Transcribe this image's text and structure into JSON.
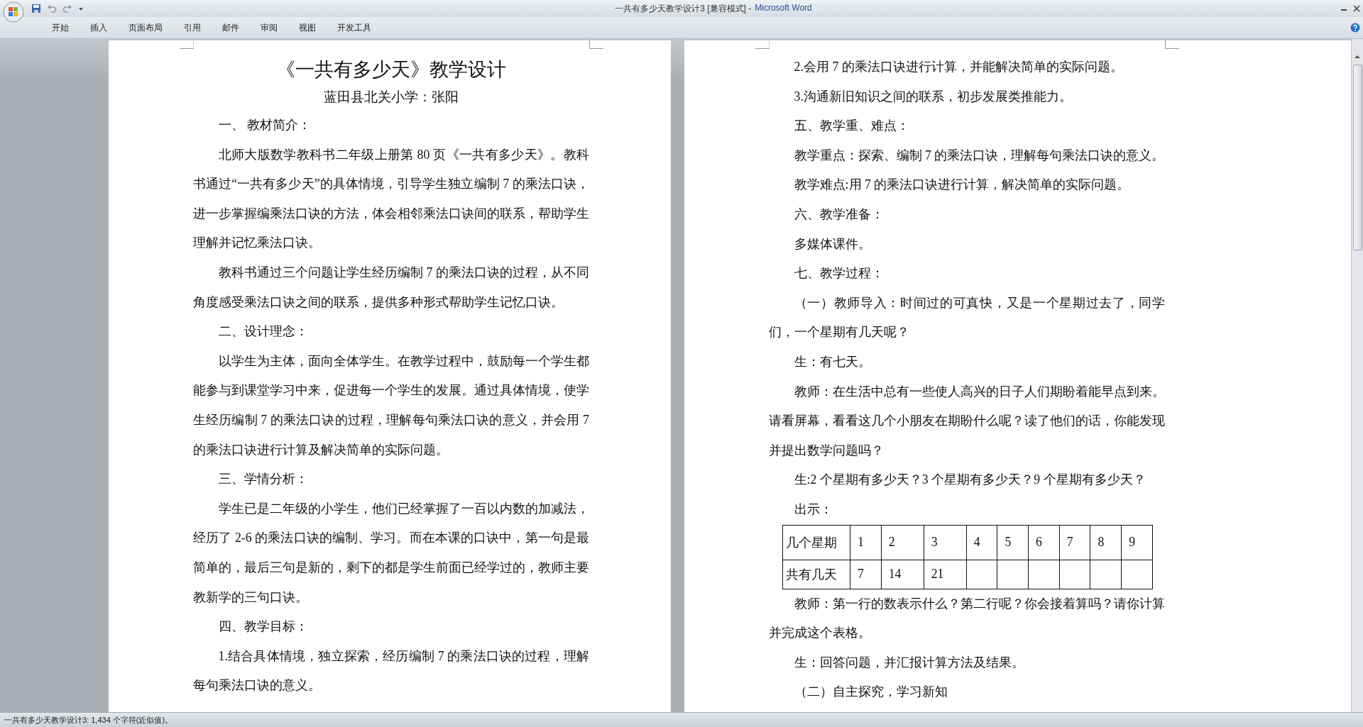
{
  "window": {
    "document_title": "一共有多少天教学设计3 [兼容模式] -",
    "app_name": "Microsoft Word"
  },
  "ribbon_tabs": [
    {
      "label": "开始",
      "selected": false
    },
    {
      "label": "插入",
      "selected": false
    },
    {
      "label": "页面布局",
      "selected": false
    },
    {
      "label": "引用",
      "selected": false
    },
    {
      "label": "邮件",
      "selected": false
    },
    {
      "label": "审阅",
      "selected": false
    },
    {
      "label": "视图",
      "selected": false
    },
    {
      "label": "开发工具",
      "selected": false
    }
  ],
  "pages": [
    {
      "blocks": [
        {
          "kind": "title",
          "text": "《一共有多少天》教学设计"
        },
        {
          "kind": "subtitle",
          "text": "蓝田县北关小学：张阳"
        },
        {
          "kind": "para",
          "text": "一、 教材简介："
        },
        {
          "kind": "para",
          "text": "北师大版数学教科书二年级上册第 80 页《一共有多少天》。教科书通过“一共有多少天”的具体情境，引导学生独立编制 7 的乘法口诀，进一步掌握编乘法口诀的方法，体会相邻乘法口诀间的联系，帮助学生理解并记忆乘法口诀。"
        },
        {
          "kind": "para",
          "text": "教科书通过三个问题让学生经历编制 7 的乘法口诀的过程，从不同角度感受乘法口诀之间的联系，提供多种形式帮助学生记忆口诀。"
        },
        {
          "kind": "para",
          "text": "二、设计理念："
        },
        {
          "kind": "para",
          "text": "以学生为主体，面向全体学生。在教学过程中，鼓励每一个学生都能参与到课堂学习中来，促进每一个学生的发展。通过具体情境，使学生经历编制 7 的乘法口诀的过程，理解每句乘法口诀的意义，并会用 7 的乘法口诀进行计算及解决简单的实际问题。"
        },
        {
          "kind": "para",
          "text": "三、学情分析："
        },
        {
          "kind": "para",
          "text": "学生已是二年级的小学生，他们已经掌握了一百以内数的加减法，经历了 2-6 的乘法口诀的编制、学习。而在本课的口诀中，第一句是最简单的，最后三句是新的，剩下的都是学生前面已经学过的，教师主要教新学的三句口诀。"
        },
        {
          "kind": "para",
          "text": "四、教学目标："
        },
        {
          "kind": "para",
          "text": "1.结合具体情境，独立探索，经历编制 7 的乘法口诀的过程，理解每句乘法口诀的意义。"
        }
      ]
    },
    {
      "blocks": [
        {
          "kind": "para",
          "text": "2.会用 7 的乘法口诀进行计算，并能解决简单的实际问题。"
        },
        {
          "kind": "para",
          "text": "3.沟通新旧知识之间的联系，初步发展类推能力。"
        },
        {
          "kind": "para",
          "text": "五、教学重、难点："
        },
        {
          "kind": "para",
          "text": "教学重点：探索、编制 7 的乘法口诀，理解每句乘法口诀的意义。"
        },
        {
          "kind": "para",
          "text": "教学难点:用 7 的乘法口诀进行计算，解决简单的实际问题。"
        },
        {
          "kind": "para",
          "text": "六、教学准备："
        },
        {
          "kind": "para",
          "text": "多媒体课件。"
        },
        {
          "kind": "para",
          "text": "七、教学过程："
        },
        {
          "kind": "para",
          "text": "（一）教师导入：时间过的可真快，又是一个星期过去了，同学们，一个星期有几天呢？"
        },
        {
          "kind": "para",
          "text": "生：有七天。"
        },
        {
          "kind": "para",
          "text": "教师：在生活中总有一些使人高兴的日子人们期盼着能早点到来。请看屏幕，看看这几个小朋友在期盼什么呢？读了他们的话，你能发现并提出数学问题吗？"
        },
        {
          "kind": "para",
          "text": "生:2 个星期有多少天？3 个星期有多少天？9 个星期有多少天？"
        },
        {
          "kind": "para",
          "text": "出示："
        },
        {
          "kind": "table",
          "rows": [
            {
              "cells": [
                "几个星期",
                "1",
                "2",
                "3",
                "4",
                "5",
                "6",
                "7",
                "8",
                "9"
              ]
            },
            {
              "cells": [
                "共有几天",
                "7",
                "14",
                "21",
                null,
                null,
                null,
                null,
                null,
                null
              ]
            }
          ]
        },
        {
          "kind": "para",
          "text": "教师：第一行的数表示什么？第二行呢？你会接着算吗？请你计算并完成这个表格。"
        },
        {
          "kind": "para",
          "text": "生：回答问题，并汇报计算方法及结果。"
        },
        {
          "kind": "para",
          "text": "（二）自主探究，学习新知"
        }
      ]
    }
  ],
  "status_bar": {
    "text": "一共有多少天教学设计3: 1,434 个字符(近似值)。"
  }
}
